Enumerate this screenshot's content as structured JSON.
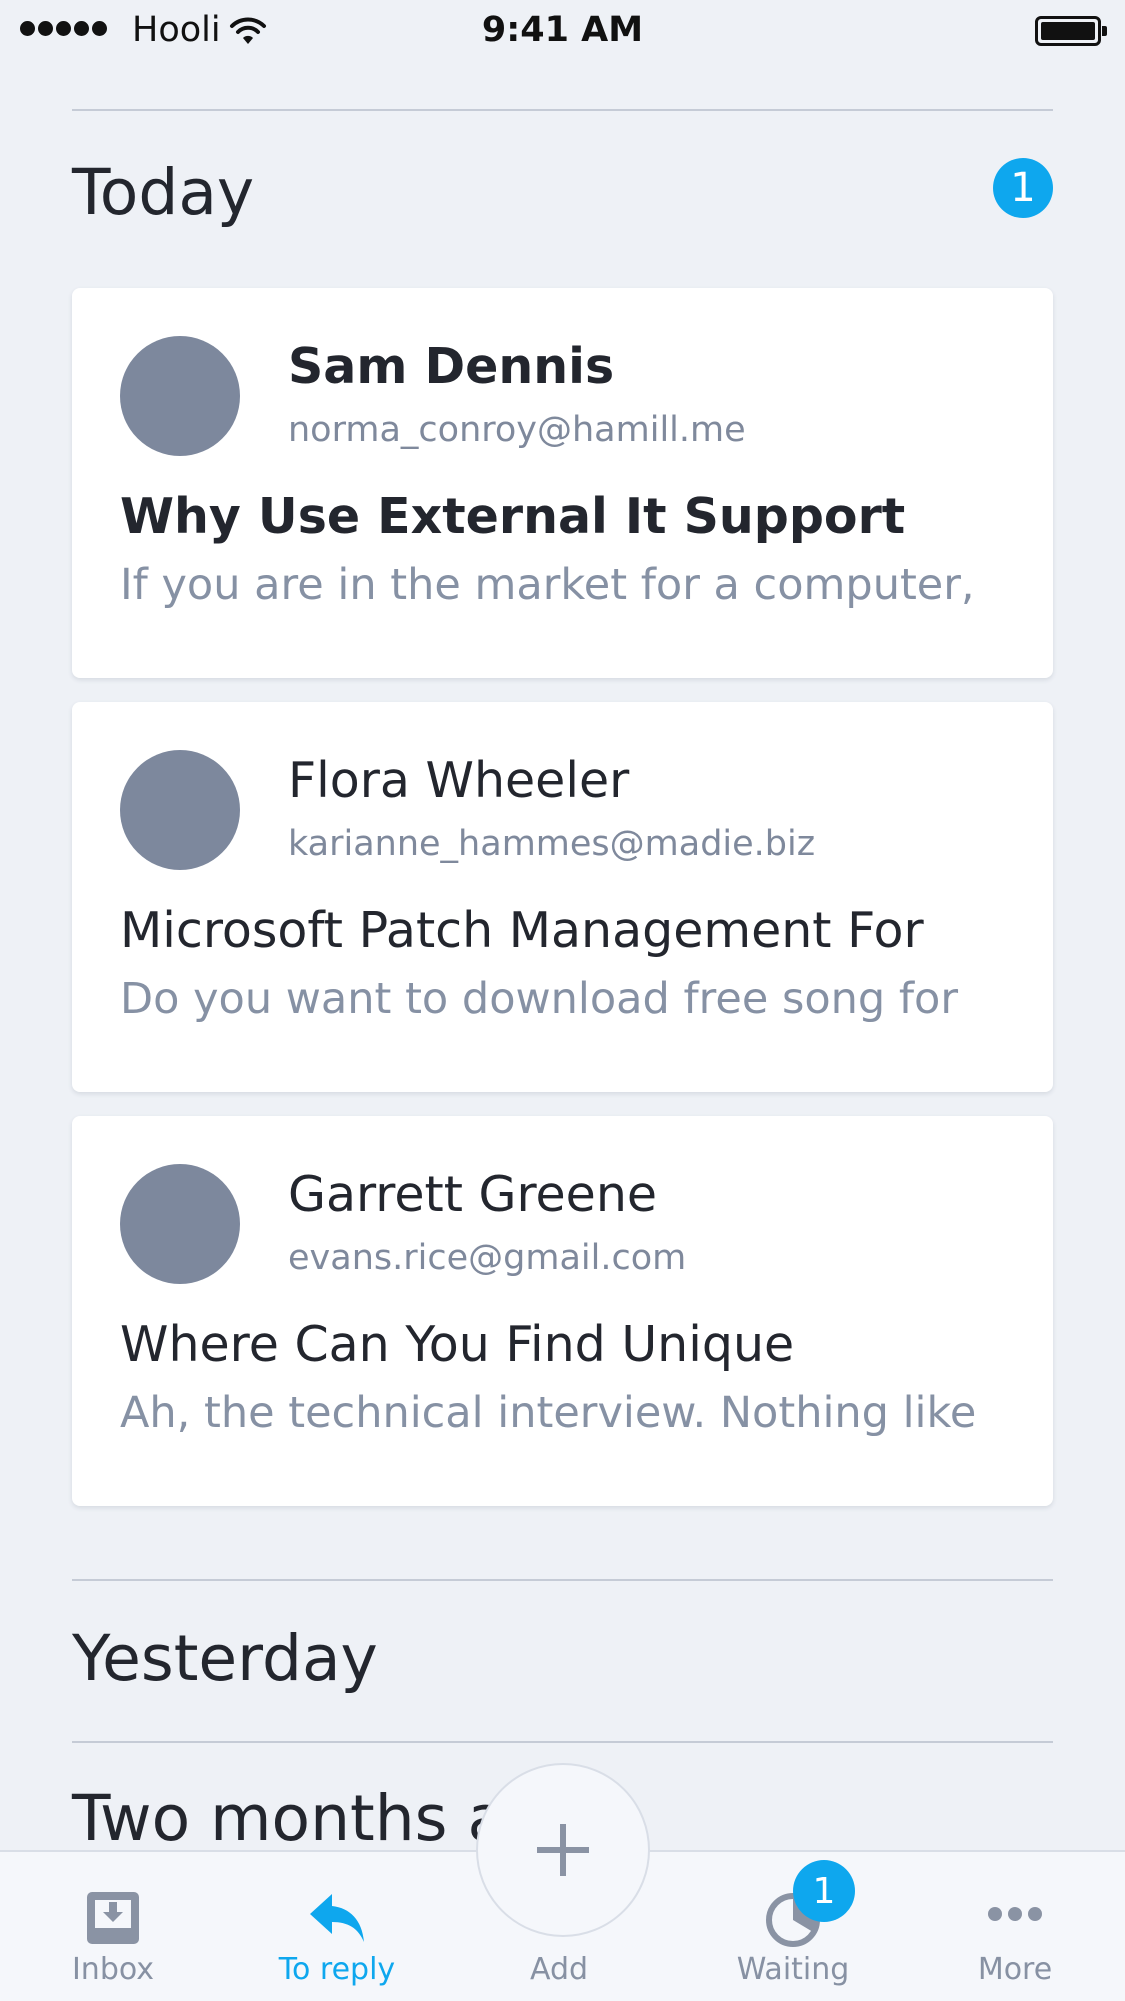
{
  "status_bar": {
    "carrier": "Hooli",
    "time": "9:41 AM"
  },
  "sections": {
    "today": {
      "title": "Today",
      "badge": "1"
    },
    "yesterday": {
      "title": "Yesterday"
    },
    "two_months_ago": {
      "title": "Two months ago"
    }
  },
  "messages": [
    {
      "sender": "Sam Dennis",
      "email": "norma_conroy@hamill.me",
      "subject": "Why Use External It Support",
      "preview": "If you are in the market for a computer,",
      "unread": true
    },
    {
      "sender": "Flora Wheeler",
      "email": "karianne_hammes@madie.biz",
      "subject": "Microsoft Patch Management For",
      "preview": "Do you want to download free song for",
      "unread": false
    },
    {
      "sender": "Garrett Greene",
      "email": "evans.rice@gmail.com",
      "subject": "Where Can You Find Unique",
      "preview": "Ah, the technical interview. Nothing like",
      "unread": false
    }
  ],
  "tab_bar": {
    "inbox": {
      "label": "Inbox",
      "icon": "inbox-icon"
    },
    "to_reply": {
      "label": "To reply",
      "icon": "reply-icon",
      "active": true
    },
    "add": {
      "label": "Add",
      "icon": "plus-icon"
    },
    "waiting": {
      "label": "Waiting",
      "icon": "waiting-icon",
      "badge": "1"
    },
    "more": {
      "label": "More",
      "icon": "more-icon"
    }
  },
  "colors": {
    "accent": "#0ea7ee",
    "background": "#eef1f6",
    "avatar": "#7d889d"
  }
}
